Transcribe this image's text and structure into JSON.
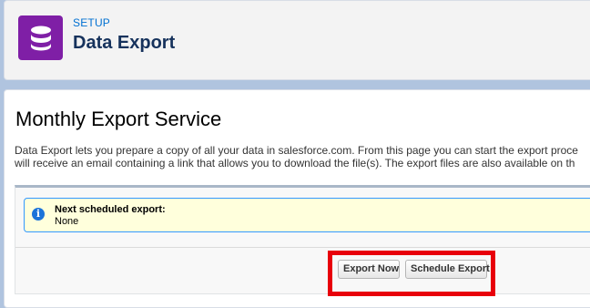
{
  "header": {
    "eyebrow": "SETUP",
    "title": "Data Export",
    "icon": "database-icon",
    "icon_color": "#7f1fa6"
  },
  "main": {
    "title": "Monthly Export Service",
    "description_lines": [
      "Data Export lets you prepare a copy of all your data in salesforce.com. From this page you can start the export proce",
      "will receive an email containing a link that allows you to download the file(s). The export files are also available on th"
    ],
    "info": {
      "icon": "info-icon",
      "heading": "Next scheduled export:",
      "value": "None"
    },
    "buttons": {
      "export_now": "Export Now",
      "schedule_export": "Schedule Export"
    }
  },
  "colors": {
    "highlight": "#e8000b",
    "link": "#0070d2"
  }
}
